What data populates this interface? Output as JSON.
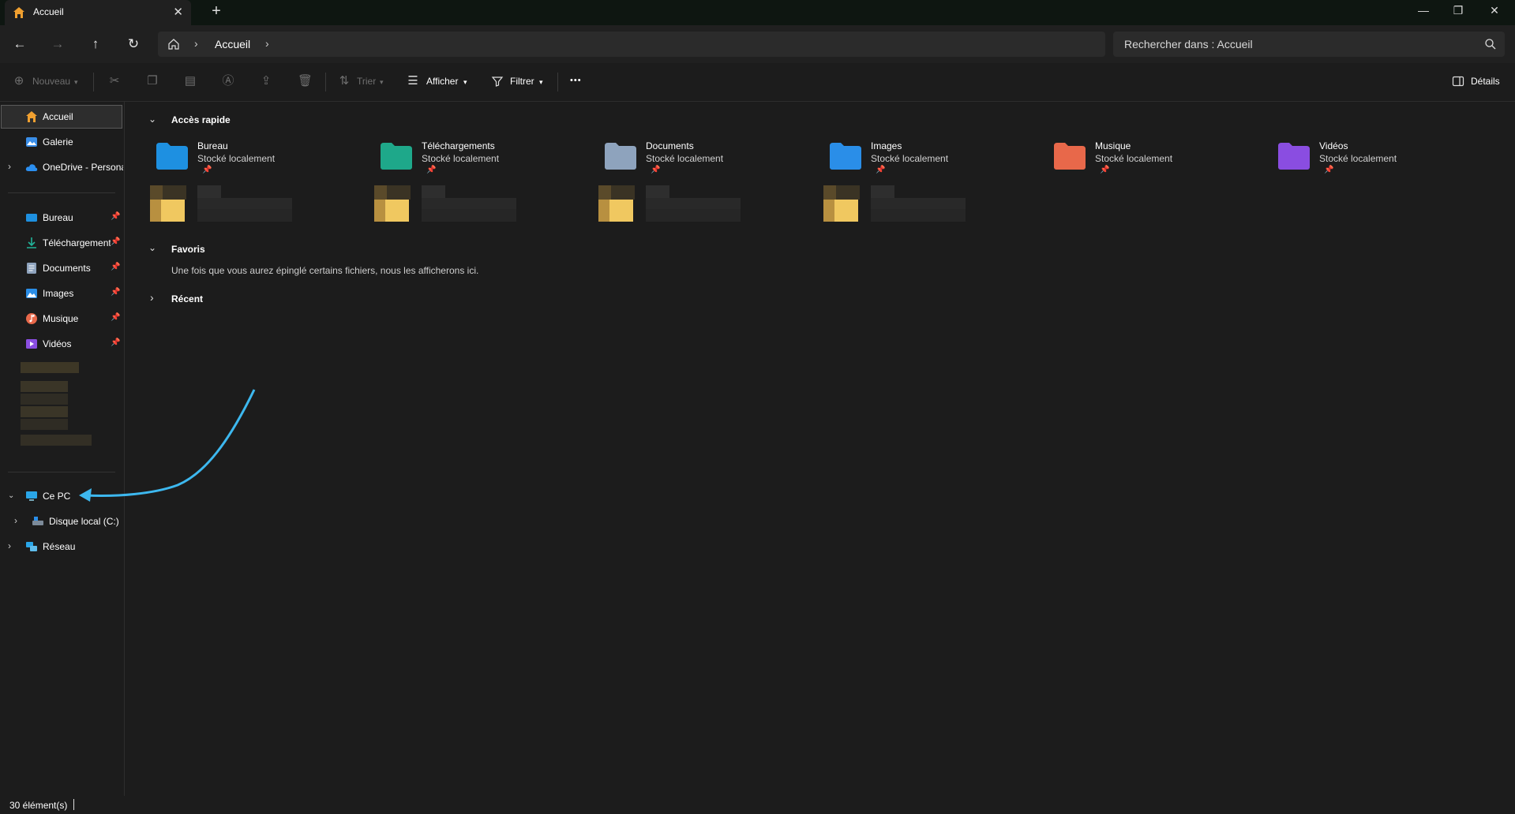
{
  "tab": {
    "title": "Accueil",
    "close": "✕",
    "new": "+"
  },
  "window_controls": {
    "minimize": "—",
    "maximize": "❐",
    "close": "✕"
  },
  "address": {
    "crumb": "Accueil",
    "sep1": "›",
    "sep2": "›"
  },
  "search": {
    "placeholder": "Rechercher dans : Accueil"
  },
  "commands": {
    "nouveau": "Nouveau",
    "trier": "Trier",
    "afficher": "Afficher",
    "filtrer": "Filtrer",
    "more": "•••",
    "details": "Détails"
  },
  "sidebar": {
    "top": [
      {
        "label": "Accueil"
      },
      {
        "label": "Galerie"
      },
      {
        "label": "OneDrive - Persona"
      }
    ],
    "pinned": [
      {
        "label": "Bureau"
      },
      {
        "label": "Téléchargement"
      },
      {
        "label": "Documents"
      },
      {
        "label": "Images"
      },
      {
        "label": "Musique"
      },
      {
        "label": "Vidéos"
      }
    ],
    "thispc": {
      "label": "Ce PC"
    },
    "disk": {
      "label": "Disque local (C:)"
    },
    "network": {
      "label": "Réseau"
    }
  },
  "sections": {
    "quick_access": "Accès rapide",
    "favorites": "Favoris",
    "favorites_empty": "Une fois que vous aurez épinglé certains fichiers, nous les afficherons ici.",
    "recent": "Récent"
  },
  "quick_access": [
    {
      "name": "Bureau",
      "sub": "Stocké localement",
      "color": "#1e90e0"
    },
    {
      "name": "Téléchargements",
      "sub": "Stocké localement",
      "color": "#1fa88a"
    },
    {
      "name": "Documents",
      "sub": "Stocké localement",
      "color": "#8ea3bd"
    },
    {
      "name": "Images",
      "sub": "Stocké localement",
      "color": "#2a8ee8"
    },
    {
      "name": "Musique",
      "sub": "Stocké localement",
      "color": "#e8684a"
    },
    {
      "name": "Vidéos",
      "sub": "Stocké localement",
      "color": "#8a4ee0"
    }
  ],
  "status": {
    "count": "30 élément(s)"
  },
  "colors": {
    "accent_arrow": "#3db8ef",
    "background": "#1c1c1c"
  }
}
